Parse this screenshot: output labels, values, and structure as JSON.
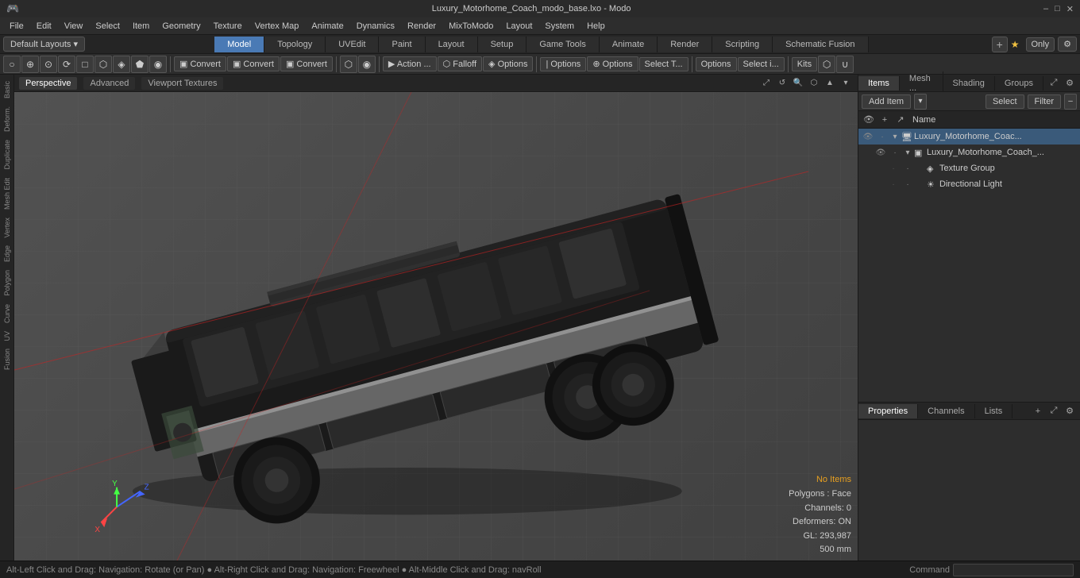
{
  "window": {
    "title": "Luxury_Motorhome_Coach_modo_base.lxo - Modo"
  },
  "titlebar": {
    "minimize": "–",
    "maximize": "□",
    "close": "✕"
  },
  "menubar": {
    "items": [
      "File",
      "Edit",
      "View",
      "Select",
      "Item",
      "Geometry",
      "Texture",
      "Vertex Map",
      "Animate",
      "Dynamics",
      "Render",
      "MixToModo",
      "Layout",
      "System",
      "Help"
    ]
  },
  "tabs": {
    "left": {
      "label": "Default Layouts",
      "dropdown": "▾"
    },
    "center": [
      {
        "label": "Model",
        "active": true
      },
      {
        "label": "Topology",
        "active": false
      },
      {
        "label": "UVEdit",
        "active": false
      },
      {
        "label": "Paint",
        "active": false
      },
      {
        "label": "Layout",
        "active": false
      },
      {
        "label": "Setup",
        "active": false
      },
      {
        "label": "Game Tools",
        "active": false
      },
      {
        "label": "Animate",
        "active": false
      },
      {
        "label": "Render",
        "active": false
      },
      {
        "label": "Scripting",
        "active": false
      },
      {
        "label": "Schematic Fusion",
        "active": false
      }
    ],
    "right": {
      "plus": "+",
      "star": "★",
      "only": "Only",
      "gear": "⚙"
    }
  },
  "toolbar": {
    "groups": [
      {
        "buttons": [
          {
            "label": "○",
            "icon": true
          },
          {
            "label": "⊕",
            "icon": true
          },
          {
            "label": "⊙",
            "icon": true
          },
          {
            "label": "⟳",
            "icon": true
          },
          {
            "label": "□",
            "icon": true
          },
          {
            "label": "⬡",
            "icon": true
          },
          {
            "label": "◈",
            "icon": true
          },
          {
            "label": "⬟",
            "icon": true
          },
          {
            "label": "◉",
            "icon": true
          }
        ]
      },
      {
        "buttons": [
          {
            "label": "Convert",
            "icon": false,
            "prefix": "▣"
          },
          {
            "label": "Convert",
            "icon": false,
            "prefix": "▣"
          },
          {
            "label": "Convert",
            "icon": false,
            "prefix": "▣"
          }
        ]
      },
      {
        "buttons": [
          {
            "label": "⬡",
            "icon": true
          },
          {
            "label": "◉",
            "icon": true
          }
        ]
      },
      {
        "buttons": [
          {
            "label": "▶ Action ...",
            "icon": false
          },
          {
            "label": "⬡ Falloff",
            "icon": false
          },
          {
            "label": "◈ Options",
            "icon": false
          }
        ]
      },
      {
        "buttons": [
          {
            "label": "| Options",
            "icon": false
          },
          {
            "label": "⊕ Options",
            "icon": false
          },
          {
            "label": "Select T...",
            "icon": false
          }
        ]
      },
      {
        "buttons": [
          {
            "label": "Options",
            "icon": false
          },
          {
            "label": "Select i...",
            "icon": false
          }
        ]
      },
      {
        "buttons": [
          {
            "label": "Kits",
            "icon": false
          },
          {
            "label": "⬡",
            "icon": true
          },
          {
            "label": "∪",
            "icon": true
          }
        ]
      }
    ]
  },
  "viewport": {
    "tabs": [
      "Perspective",
      "Advanced",
      "Viewport Textures"
    ],
    "active_tab": "Perspective",
    "icons": [
      "⤢",
      "↺",
      "🔍",
      "⬡",
      "▲",
      "▾"
    ]
  },
  "left_sidebar": {
    "items": [
      "Basic",
      "Deform.",
      "Duplicate",
      "Mesh Edit",
      "Vertex",
      "Edge",
      "Polygon",
      "Curve",
      "UV",
      "Fusion"
    ]
  },
  "scene_status": {
    "no_items": "No Items",
    "polygons": "Polygons : Face",
    "channels": "Channels: 0",
    "deformers": "Deformers: ON",
    "gl": "GL: 293,987",
    "size": "500 mm"
  },
  "right_panel": {
    "tabs": [
      "Items",
      "Mesh ...",
      "Shading",
      "Groups"
    ],
    "active_tab": "Items",
    "toolbar": {
      "add_item": "Add Item",
      "select": "Select",
      "filter": "Filter",
      "more": "–"
    },
    "icons": [
      "👁",
      "+",
      "↗"
    ],
    "name_header": "Name",
    "tree": [
      {
        "id": "root",
        "label": "Luxury_Motorhome_Coac...",
        "icon": "🖥",
        "indent": 0,
        "arrow": "▾",
        "eye": true,
        "lock": true
      },
      {
        "id": "mesh",
        "label": "Luxury_Motorhome_Coach_...",
        "icon": "▣",
        "indent": 1,
        "arrow": "▾",
        "eye": true,
        "lock": true
      },
      {
        "id": "texture",
        "label": "Texture Group",
        "icon": "◈",
        "indent": 2,
        "arrow": "",
        "eye": false,
        "lock": true
      },
      {
        "id": "light",
        "label": "Directional Light",
        "icon": "☀",
        "indent": 2,
        "arrow": "",
        "eye": false,
        "lock": true
      }
    ]
  },
  "bottom_panel": {
    "tabs": [
      "Properties",
      "Channels",
      "Lists"
    ],
    "active_tab": "Properties",
    "plus": "+"
  },
  "statusbar": {
    "text": "Alt-Left Click and Drag: Navigation: Rotate (or Pan)  ●  Alt-Right Click and Drag: Navigation: Freewheel  ●  Alt-Middle Click and Drag: navRoll",
    "dot1_blue": true,
    "dot2_blue": false,
    "command_label": "Command",
    "command_placeholder": ""
  }
}
